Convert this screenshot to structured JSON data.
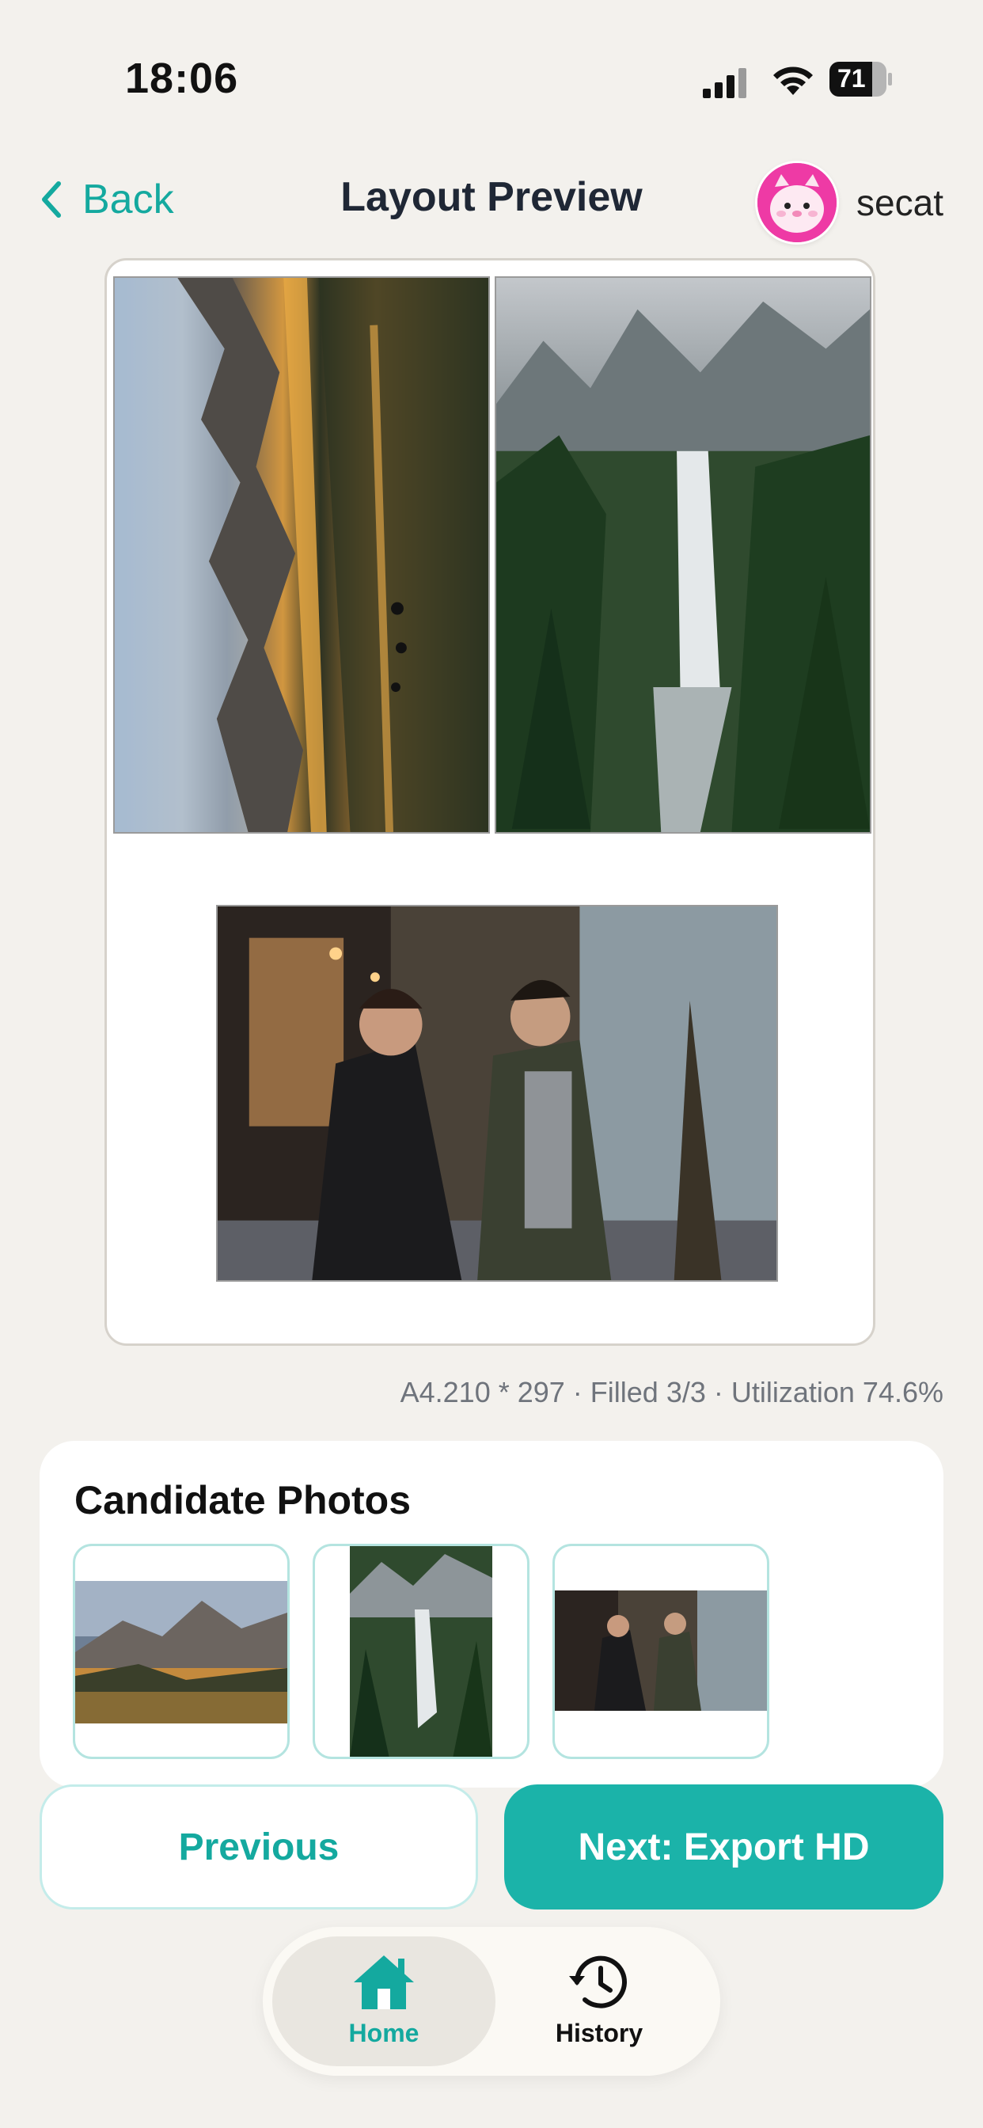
{
  "status_bar": {
    "time": "18:06",
    "battery_level": "71"
  },
  "header": {
    "back_label": "Back",
    "title": "Layout Preview",
    "username": "secat"
  },
  "preview": {
    "photos": [
      {
        "name": "mountain-lake-sunset",
        "rotation": "rotated 90°"
      },
      {
        "name": "waterfall-forest"
      },
      {
        "name": "couple-street"
      }
    ]
  },
  "summary": "A4.210 * 297 · Filled 3/3 · Utilization 74.6%",
  "candidates": {
    "title": "Candidate Photos",
    "items": [
      {
        "name": "mountain-lake"
      },
      {
        "name": "waterfall"
      },
      {
        "name": "couple-street"
      }
    ]
  },
  "buttons": {
    "previous": "Previous",
    "next": "Next: Export HD"
  },
  "tabs": [
    {
      "label": "Home",
      "icon": "home-icon",
      "active": true
    },
    {
      "label": "History",
      "icon": "history-icon",
      "active": false
    }
  ],
  "colors": {
    "accent": "#1bb3a9",
    "accent_text": "#14a99f",
    "background": "#f3f1ed"
  }
}
